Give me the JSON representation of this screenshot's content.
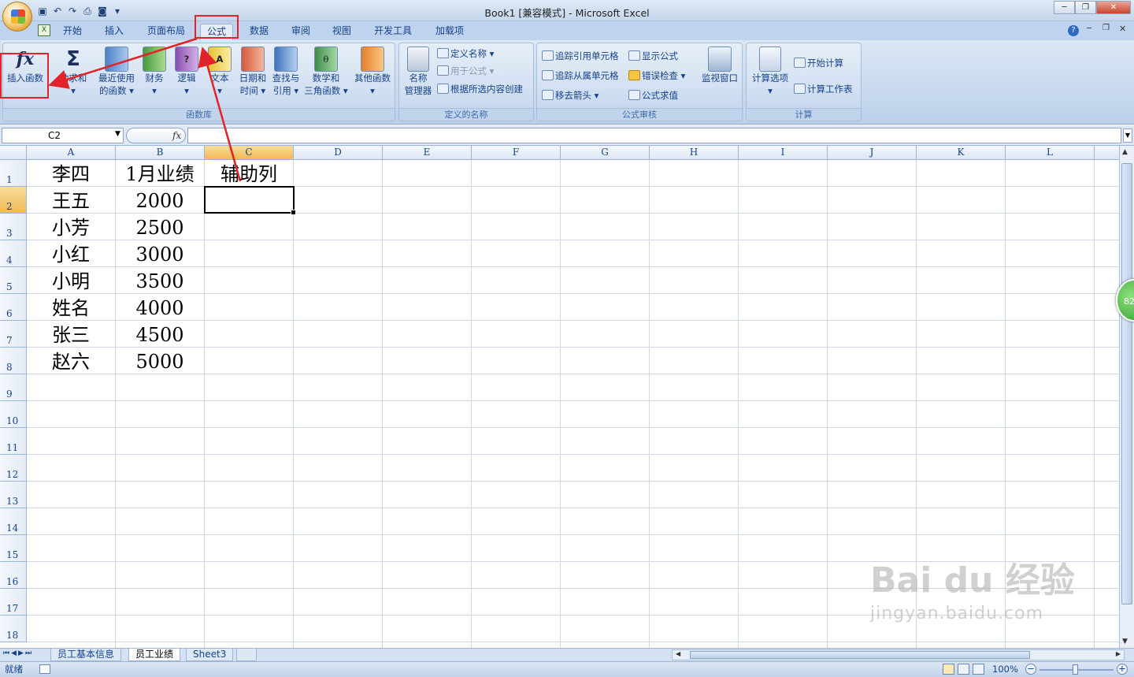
{
  "window": {
    "title": "Book1 [兼容模式] - Microsoft Excel",
    "controls": [
      "minimize",
      "restore",
      "close"
    ]
  },
  "ribbon_tabs": [
    "开始",
    "插入",
    "页面布局",
    "公式",
    "数据",
    "审阅",
    "视图",
    "开发工具",
    "加载项"
  ],
  "active_tab": "公式",
  "groups": {
    "function_library": {
      "label": "函数库",
      "buttons": [
        {
          "label": "插入函数",
          "icon": "fx-icon"
        },
        {
          "label": "自动求和",
          "icon": "sigma-icon"
        },
        {
          "label": "最近使用的函数",
          "label1": "最近使用",
          "label2": "的函数 ▾",
          "icon": "book-blue-icon"
        },
        {
          "label": "财务",
          "label2": "▾",
          "icon": "book-green-icon"
        },
        {
          "label": "逻辑",
          "label2": "▾",
          "icon": "book-purple-icon"
        },
        {
          "label": "文本",
          "label2": "▾",
          "icon": "book-yellow-icon"
        },
        {
          "label": "日期和时间",
          "label1": "日期和",
          "label2": "时间 ▾",
          "icon": "book-red-icon"
        },
        {
          "label": "查找与引用",
          "label1": "查找与",
          "label2": "引用 ▾",
          "icon": "book-search-icon"
        },
        {
          "label": "数学和三角函数",
          "label1": "数学和",
          "label2": "三角函数 ▾",
          "icon": "book-theta-icon"
        },
        {
          "label": "其他函数",
          "label2": "▾",
          "icon": "book-orange-icon"
        }
      ],
      "autosum_first": "动求和",
      "autosum_caret": "▾"
    },
    "defined_names": {
      "label": "定义的名称",
      "name_manager_1": "名称",
      "name_manager_2": "管理器",
      "define_name": "定义名称 ▾",
      "use_in_formula": "用于公式 ▾",
      "create_from_selection": "根据所选内容创建"
    },
    "formula_auditing": {
      "label": "公式审核",
      "trace_precedents": "追踪引用单元格",
      "trace_dependents": "追踪从属单元格",
      "remove_arrows": "移去箭头 ▾",
      "show_formulas": "显示公式",
      "error_checking": "错误检查 ▾",
      "evaluate_formula": "公式求值",
      "watch_window": "监视窗口"
    },
    "calculation": {
      "label": "计算",
      "calc_options": "计算选项",
      "calc_options_caret": "▾",
      "calc_now": "开始计算",
      "calc_sheet": "计算工作表"
    }
  },
  "formula_bar": {
    "name_box": "C2",
    "fx": "fx",
    "content": ""
  },
  "columns": [
    "A",
    "B",
    "C",
    "D",
    "E",
    "F",
    "G",
    "H",
    "I",
    "J",
    "K",
    "L"
  ],
  "rows": [
    "1",
    "2",
    "3",
    "4",
    "5",
    "6",
    "7",
    "8",
    "9",
    "10",
    "11",
    "12",
    "13",
    "14",
    "15",
    "16",
    "17",
    "18"
  ],
  "cells": {
    "A": [
      "李四",
      "王五",
      "小芳",
      "小红",
      "小明",
      "姓名",
      "张三",
      "赵六"
    ],
    "B": [
      "1月业绩",
      "2000",
      "2500",
      "3000",
      "3500",
      "4000",
      "4500",
      "5000"
    ],
    "C": [
      "辅助列"
    ]
  },
  "selected_cell": "C2",
  "sheet_tabs": [
    "员工基本信息",
    "员工业绩",
    "Sheet3"
  ],
  "active_sheet": "员工业绩",
  "status": {
    "mode": "就绪",
    "zoom": "100%"
  },
  "badge": "82",
  "watermark": {
    "main": "Bai du 经验",
    "url": "jingyan.baidu.com"
  }
}
